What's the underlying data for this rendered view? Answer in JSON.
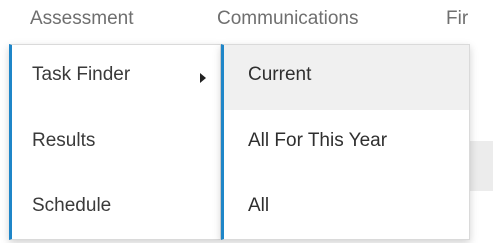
{
  "menubar": {
    "items": [
      "Assessment",
      "Communications",
      "Fir"
    ]
  },
  "dropdown": {
    "items": [
      {
        "label": "Task Finder",
        "has_submenu": true
      },
      {
        "label": "Results"
      },
      {
        "label": "Schedule"
      }
    ]
  },
  "submenu": {
    "items": [
      {
        "label": "Current",
        "active": true
      },
      {
        "label": "All For This Year"
      },
      {
        "label": "All"
      }
    ]
  },
  "colors": {
    "accent": "#1f86c8",
    "active_bg": "#f0f0f0",
    "menubar_text": "#6f6f6f"
  }
}
